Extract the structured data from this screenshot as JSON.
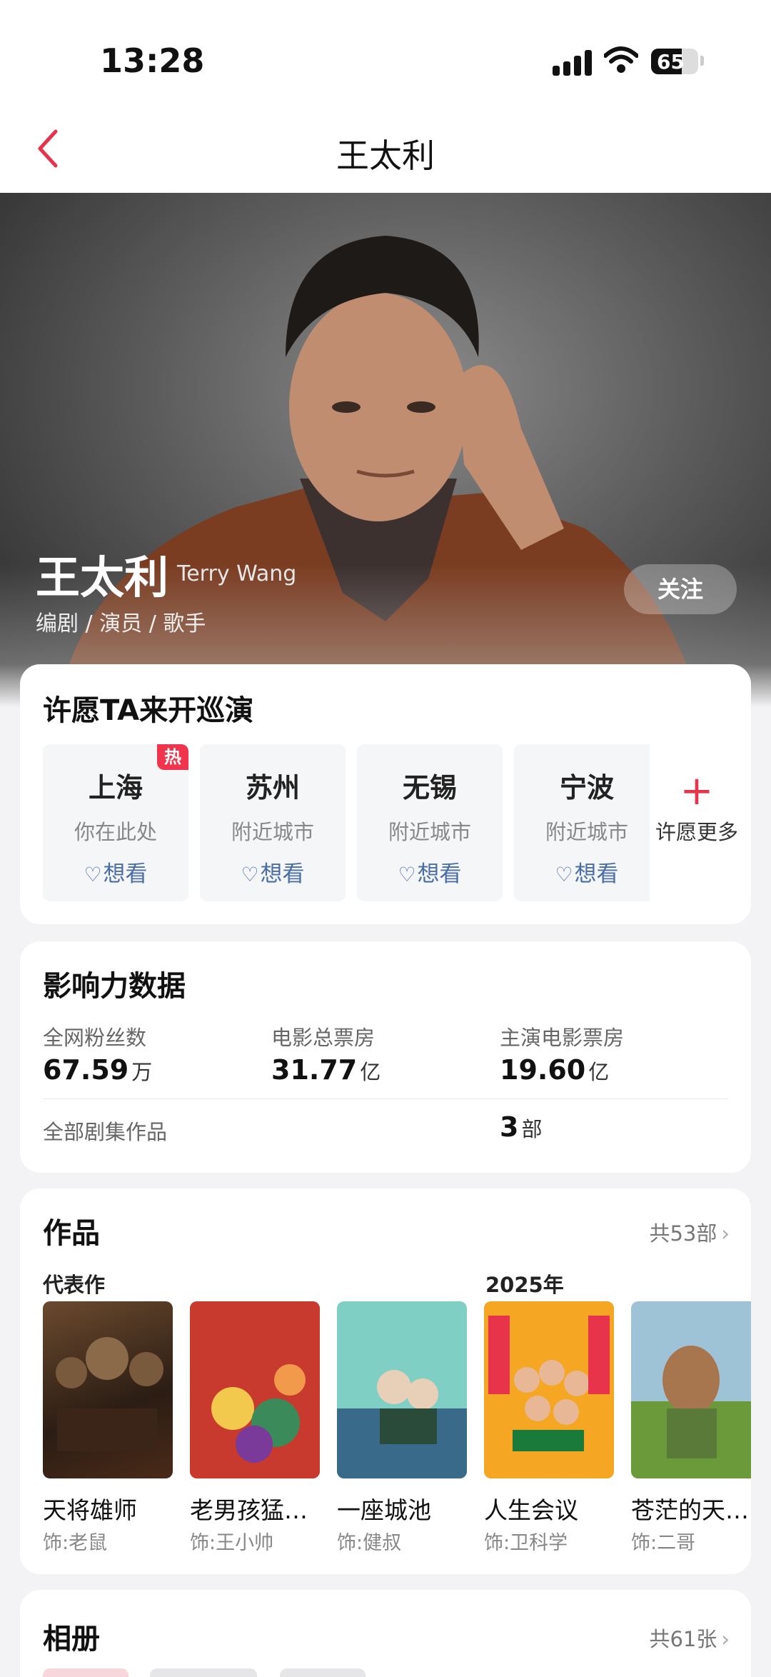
{
  "status_bar": {
    "time": "13:28",
    "battery": "65",
    "battery_level": 0.65
  },
  "header": {
    "title": "王太利",
    "back_icon": "chevron-left-icon"
  },
  "profile": {
    "name": "王太利",
    "english_name": "Terry Wang",
    "roles": "编剧 / 演员 / 歌手",
    "follow_label": "关注"
  },
  "wish": {
    "title": "许愿TA来开巡演",
    "cities": [
      {
        "name": "上海",
        "subtitle": "你在此处",
        "want_label": "想看",
        "badge": "热"
      },
      {
        "name": "苏州",
        "subtitle": "附近城市",
        "want_label": "想看"
      },
      {
        "name": "无锡",
        "subtitle": "附近城市",
        "want_label": "想看"
      },
      {
        "name": "宁波",
        "subtitle": "附近城市",
        "want_label": "想看"
      }
    ],
    "more_label": "许愿更多",
    "accent_color": "#e8344a"
  },
  "influence": {
    "title": "影响力数据",
    "stats": [
      {
        "label": "全网粉丝数",
        "value": "67.59",
        "unit": "万"
      },
      {
        "label": "电影总票房",
        "value": "31.77",
        "unit": "亿"
      },
      {
        "label": "主演电影票房",
        "value": "19.60",
        "unit": "亿"
      }
    ],
    "series": {
      "label": "全部剧集作品",
      "value": "3",
      "unit": "部"
    }
  },
  "works": {
    "title": "作品",
    "total_label": "共53部",
    "representative_label": "代表作",
    "year_label": "2025年",
    "items": [
      {
        "title": "天将雄师",
        "role": "饰:老鼠"
      },
      {
        "title": "老男孩猛…",
        "role": "饰:王小帅"
      },
      {
        "title": "一座城池",
        "role": "饰:健叔"
      },
      {
        "title": "人生会议",
        "role": "饰:卫科学"
      },
      {
        "title": "苍茫的天…",
        "role": "饰:二哥"
      }
    ]
  },
  "album": {
    "title": "相册",
    "total_label": "共61张"
  }
}
